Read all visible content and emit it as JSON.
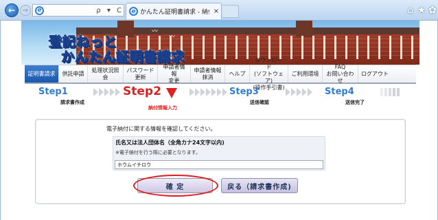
{
  "browser": {
    "tab_title": "かんたん証明書請求 - 納付...",
    "addr_search_glyph": "ρ",
    "addr_dropdown_glyph": "▾",
    "addr_refresh_glyph": "C",
    "tab_close_glyph": "×",
    "back_glyph": "←",
    "forward_glyph": "→",
    "home_glyph": "⌂",
    "star_glyph": "★",
    "gear_glyph": "✿",
    "ie_glyph": "e"
  },
  "banner": {
    "logo_line1": "登記ねっと",
    "logo_line2": "かんたん証明書請求"
  },
  "menu": [
    {
      "label": "証明書請求",
      "active": true
    },
    {
      "label": "供託申請"
    },
    {
      "label": "処理状況照会"
    },
    {
      "label": "パスワード\n更新"
    },
    {
      "label": "申請者情報\n変更"
    },
    {
      "label": "申請者情報\n抹消"
    },
    {
      "label": "ヘルプ"
    },
    {
      "label": "ダウンロード\n(ソフトウェア)\n(操作手引書)"
    },
    {
      "label": "ご利用環境"
    },
    {
      "label": "FAQ\nお問い合わせ"
    },
    {
      "label": "ログアウト"
    }
  ],
  "steps": [
    {
      "name": "Step1",
      "desc": "請求書作成"
    },
    {
      "name": "Step2",
      "desc": "納付情報入力",
      "current": true
    },
    {
      "name": "Step3",
      "desc": "送信確認"
    },
    {
      "name": "Step4",
      "desc": "送信完了"
    }
  ],
  "form": {
    "intro": "電子納付に関する情報を確認してください。",
    "field_label": "氏名又は法人団体名（全角カナ24文字以内)",
    "field_note": "※電子納付を行う際に必要となります。",
    "field_value": "ホウムイチロウ",
    "confirm_label": "確 定",
    "back_label": "戻る（請求書作成)"
  },
  "colors": {
    "accent_blue": "#2f7dd6",
    "current_step_red": "#e02020",
    "highlight_red": "#e01b1b"
  }
}
